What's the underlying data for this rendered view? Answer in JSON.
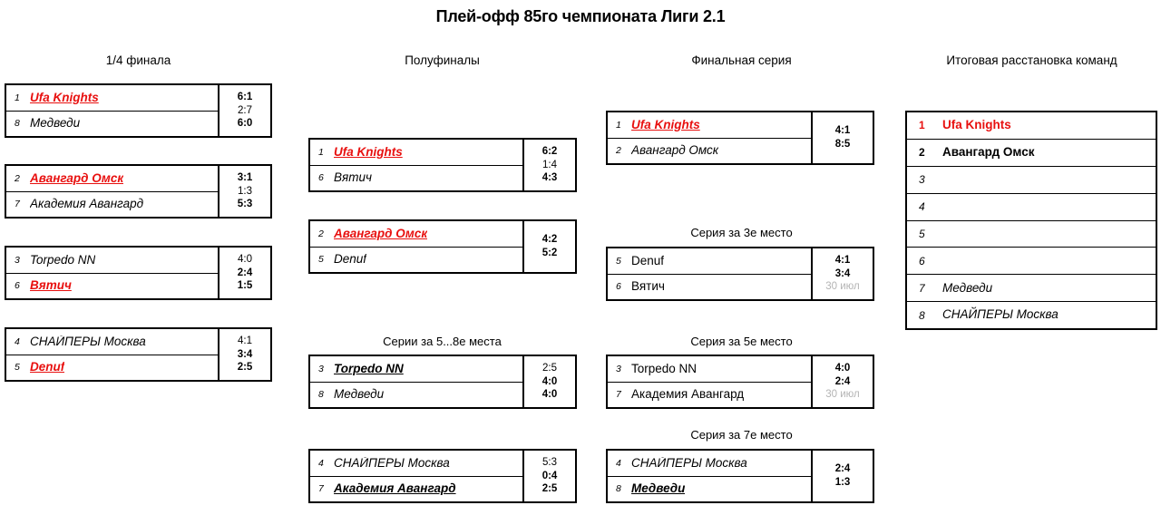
{
  "title": "Плей-офф 85го чемпионата Лиги 2.1",
  "columns": {
    "quarterfinals": "1/4 финала",
    "semifinals": "Полуфиналы",
    "final_series": "Финальная серия",
    "standings": "Итоговая расстановка команд"
  },
  "section_headers": {
    "places_5_8": "Серии за 5...8е места",
    "place_3": "Серия за 3е место",
    "place_5": "Серия за 5е место",
    "place_7": "Серия за 7е место"
  },
  "quarterfinals": [
    {
      "top": {
        "seed": "1",
        "team": "Ufa Knights",
        "winner": true,
        "red": true
      },
      "bottom": {
        "seed": "8",
        "team": "Медведи",
        "winner": false,
        "red": false
      },
      "games": [
        {
          "score": "6:1",
          "bold": true
        },
        {
          "score": "2:7",
          "bold": false
        },
        {
          "score": "6:0",
          "bold": true
        }
      ]
    },
    {
      "top": {
        "seed": "2",
        "team": "Авангард Омск",
        "winner": true,
        "red": true
      },
      "bottom": {
        "seed": "7",
        "team": "Академия Авангард",
        "winner": false,
        "red": false
      },
      "games": [
        {
          "score": "3:1",
          "bold": true
        },
        {
          "score": "1:3",
          "bold": false
        },
        {
          "score": "5:3",
          "bold": true
        }
      ]
    },
    {
      "top": {
        "seed": "3",
        "team": "Torpedo NN",
        "winner": false,
        "red": false
      },
      "bottom": {
        "seed": "6",
        "team": "Вятич",
        "winner": true,
        "red": true
      },
      "games": [
        {
          "score": "4:0",
          "bold": false
        },
        {
          "score": "2:4",
          "bold": true
        },
        {
          "score": "1:5",
          "bold": true
        }
      ]
    },
    {
      "top": {
        "seed": "4",
        "team": "СНАЙПЕРЫ Москва",
        "winner": false,
        "red": false
      },
      "bottom": {
        "seed": "5",
        "team": "Denuf",
        "winner": true,
        "red": true
      },
      "games": [
        {
          "score": "4:1",
          "bold": false
        },
        {
          "score": "3:4",
          "bold": true
        },
        {
          "score": "2:5",
          "bold": true
        }
      ]
    }
  ],
  "semifinals": [
    {
      "top": {
        "seed": "1",
        "team": "Ufa Knights",
        "winner": true,
        "red": true
      },
      "bottom": {
        "seed": "6",
        "team": "Вятич",
        "winner": false,
        "red": false
      },
      "games": [
        {
          "score": "6:2",
          "bold": true
        },
        {
          "score": "1:4",
          "bold": false
        },
        {
          "score": "4:3",
          "bold": true
        }
      ]
    },
    {
      "top": {
        "seed": "2",
        "team": "Авангард Омск",
        "winner": true,
        "red": true
      },
      "bottom": {
        "seed": "5",
        "team": "Denuf",
        "winner": false,
        "red": false
      },
      "games": [
        {
          "score": "4:2",
          "bold": true
        },
        {
          "score": "5:2",
          "bold": true
        }
      ]
    }
  ],
  "series_5_8": [
    {
      "top": {
        "seed": "3",
        "team": "Torpedo NN",
        "winner": true,
        "red": false
      },
      "bottom": {
        "seed": "8",
        "team": "Медведи",
        "winner": false,
        "red": false
      },
      "games": [
        {
          "score": "2:5",
          "bold": false
        },
        {
          "score": "4:0",
          "bold": true
        },
        {
          "score": "4:0",
          "bold": true
        }
      ]
    },
    {
      "top": {
        "seed": "4",
        "team": "СНАЙПЕРЫ Москва",
        "winner": false,
        "red": false
      },
      "bottom": {
        "seed": "7",
        "team": "Академия Авангард",
        "winner": true,
        "red": false
      },
      "games": [
        {
          "score": "5:3",
          "bold": false
        },
        {
          "score": "0:4",
          "bold": true
        },
        {
          "score": "2:5",
          "bold": true
        }
      ]
    }
  ],
  "final_series": {
    "top": {
      "seed": "1",
      "team": "Ufa Knights",
      "winner": true,
      "red": true
    },
    "bottom": {
      "seed": "2",
      "team": "Авангард Омск",
      "winner": false,
      "red": false
    },
    "games": [
      {
        "score": "4:1",
        "bold": true
      },
      {
        "score": "8:5",
        "bold": true
      }
    ]
  },
  "series_place_3": {
    "top": {
      "seed": "5",
      "team": "Denuf",
      "winner": false,
      "red": false,
      "upright": true
    },
    "bottom": {
      "seed": "6",
      "team": "Вятич",
      "winner": false,
      "red": false,
      "upright": true
    },
    "games": [
      {
        "score": "4:1",
        "bold": true
      },
      {
        "score": "3:4",
        "bold": true
      },
      {
        "score": "30 июл",
        "bold": false,
        "gray": true
      }
    ]
  },
  "series_place_5": {
    "top": {
      "seed": "3",
      "team": "Torpedo NN",
      "winner": false,
      "red": false,
      "upright": true
    },
    "bottom": {
      "seed": "7",
      "team": "Академия Авангард",
      "winner": false,
      "red": false,
      "upright": true
    },
    "games": [
      {
        "score": "4:0",
        "bold": true
      },
      {
        "score": "2:4",
        "bold": true
      },
      {
        "score": "30 июл",
        "bold": false,
        "gray": true
      }
    ]
  },
  "series_place_7": {
    "top": {
      "seed": "4",
      "team": "СНАЙПЕРЫ Москва",
      "winner": false,
      "red": false
    },
    "bottom": {
      "seed": "8",
      "team": "Медведи",
      "winner": true,
      "red": false
    },
    "games": [
      {
        "score": "2:4",
        "bold": true
      },
      {
        "score": "1:3",
        "bold": true
      }
    ]
  },
  "standings_rows": [
    {
      "pos": "1",
      "team": "Ufa Knights",
      "style": "red"
    },
    {
      "pos": "2",
      "team": "Авангард Омск",
      "style": "strong"
    },
    {
      "pos": "3",
      "team": "",
      "style": "italic"
    },
    {
      "pos": "4",
      "team": "",
      "style": "italic"
    },
    {
      "pos": "5",
      "team": "",
      "style": "italic"
    },
    {
      "pos": "6",
      "team": "",
      "style": "italic"
    },
    {
      "pos": "7",
      "team": "Медведи",
      "style": "italic"
    },
    {
      "pos": "8",
      "team": "СНАЙПЕРЫ Москва",
      "style": "italic"
    }
  ],
  "colors": {
    "accent_red": "#e8100f",
    "pending_gray": "#b4b4b4",
    "border": "#000000"
  }
}
